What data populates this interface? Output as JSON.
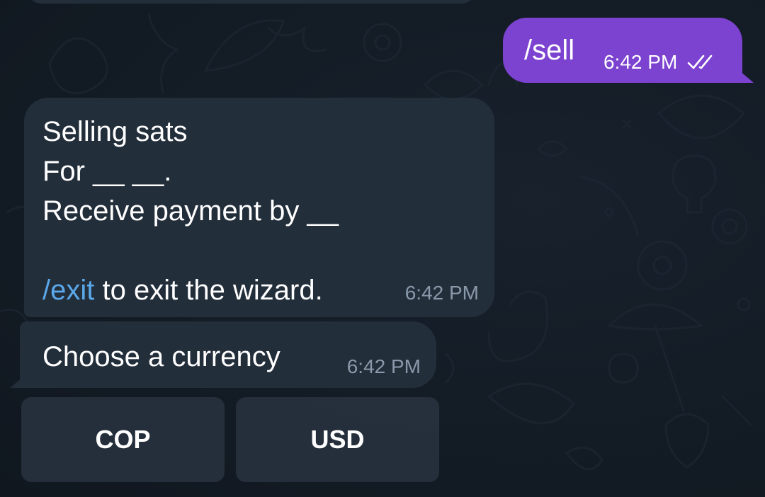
{
  "outgoing": {
    "text": "/sell",
    "time": "6:42 PM",
    "status_icon": "double-check-icon"
  },
  "incoming_wizard": {
    "lines": [
      "Selling sats",
      "For __ __.",
      "Receive payment by __",
      ""
    ],
    "exit_command": "/exit",
    "exit_rest": " to exit the wizard.",
    "time": "6:42 PM"
  },
  "incoming_prompt": {
    "text": "Choose a currency",
    "time": "6:42 PM"
  },
  "keyboard": {
    "buttons": [
      {
        "label": "COP"
      },
      {
        "label": "USD"
      }
    ]
  },
  "colors": {
    "background": "#141c26",
    "outgoing_bubble": "#7c42d0",
    "incoming_bubble": "#232e3b",
    "link": "#5aa8ea",
    "meta_text": "#8a99aa"
  }
}
